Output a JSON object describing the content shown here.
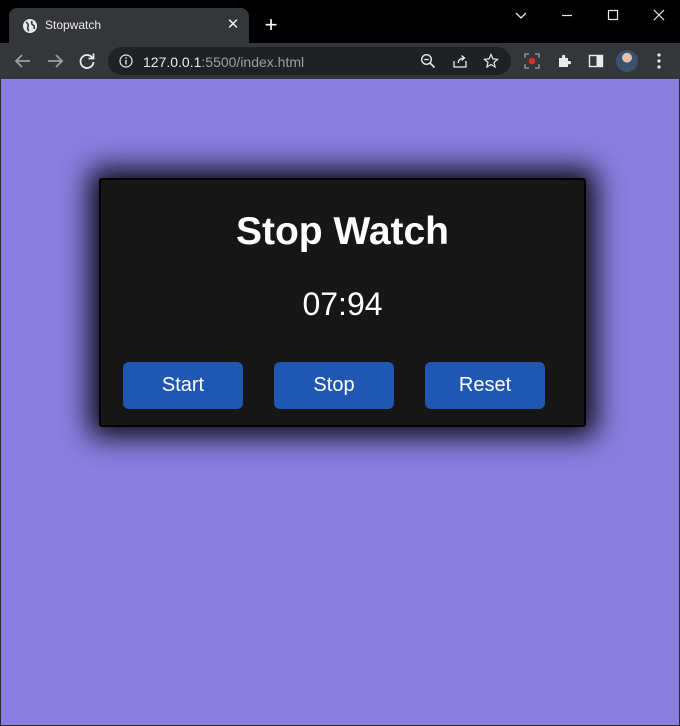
{
  "browser": {
    "tab": {
      "title": "Stopwatch",
      "close_glyph": "✕",
      "favicon_icon": "globe-icon"
    },
    "new_tab_glyph": "+",
    "url": {
      "host": "127.0.0.1",
      "path": ":5500/index.html"
    },
    "icons": [
      "back-arrow-icon",
      "forward-arrow-icon",
      "reload-icon",
      "site-info-icon",
      "zoom-icon",
      "share-icon",
      "bookmark-star-icon",
      "screen-recorder-icon",
      "extensions-puzzle-icon",
      "side-panel-icon",
      "avatar",
      "menu-kebab-icon"
    ]
  },
  "page": {
    "background_color": "#8a7ee0",
    "card_color": "#171616",
    "button_color": "#1f57b3",
    "title": "Stop Watch",
    "time": "07:94",
    "buttons": {
      "start": "Start",
      "stop": "Stop",
      "reset": "Reset"
    }
  }
}
